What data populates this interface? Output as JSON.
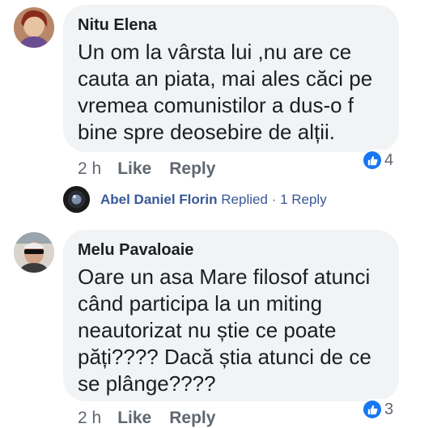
{
  "comments": [
    {
      "author": "Nitu Elena",
      "text": "Un om la vârsta lui ,nu are ce\ncauta an piata, mai ales căci pe\nvremea comunistilor a dus-o f\nbine spre deosebire de alții.",
      "time": "2 h",
      "like_label": "Like",
      "reply_label": "Reply",
      "reaction_count": "4",
      "reaction_icon": "like-icon",
      "replied": {
        "name": "Abel Daniel Florin",
        "action": "Replied",
        "separator": "·",
        "replies": "1 Reply"
      }
    },
    {
      "author": "Melu Pavaloaie",
      "text": "Oare un asa Mare filosof atunci\ncând participa la un miting\nneautorizat nu știe ce poate\npăți???? Dacă știa atunci de ce\nse plânge????",
      "time": "2 h",
      "like_label": "Like",
      "reply_label": "Reply",
      "reaction_count": "3",
      "reaction_icon": "like-icon"
    }
  ],
  "colors": {
    "bubble": "#f2f3f5",
    "link": "#385898",
    "like_blue": "#1877f2",
    "meta": "#606770"
  }
}
